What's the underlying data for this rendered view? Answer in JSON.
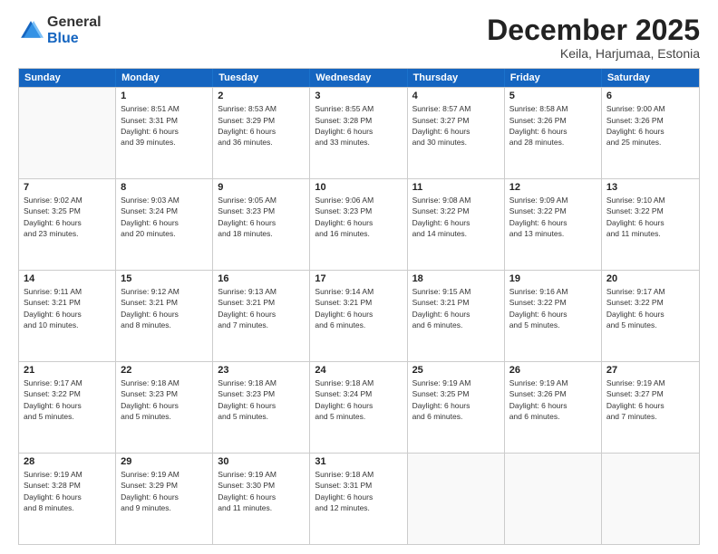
{
  "header": {
    "logo_general": "General",
    "logo_blue": "Blue",
    "title": "December 2025",
    "subtitle": "Keila, Harjumaa, Estonia"
  },
  "days_of_week": [
    "Sunday",
    "Monday",
    "Tuesday",
    "Wednesday",
    "Thursday",
    "Friday",
    "Saturday"
  ],
  "weeks": [
    [
      {
        "day": "",
        "info": ""
      },
      {
        "day": "1",
        "info": "Sunrise: 8:51 AM\nSunset: 3:31 PM\nDaylight: 6 hours\nand 39 minutes."
      },
      {
        "day": "2",
        "info": "Sunrise: 8:53 AM\nSunset: 3:29 PM\nDaylight: 6 hours\nand 36 minutes."
      },
      {
        "day": "3",
        "info": "Sunrise: 8:55 AM\nSunset: 3:28 PM\nDaylight: 6 hours\nand 33 minutes."
      },
      {
        "day": "4",
        "info": "Sunrise: 8:57 AM\nSunset: 3:27 PM\nDaylight: 6 hours\nand 30 minutes."
      },
      {
        "day": "5",
        "info": "Sunrise: 8:58 AM\nSunset: 3:26 PM\nDaylight: 6 hours\nand 28 minutes."
      },
      {
        "day": "6",
        "info": "Sunrise: 9:00 AM\nSunset: 3:26 PM\nDaylight: 6 hours\nand 25 minutes."
      }
    ],
    [
      {
        "day": "7",
        "info": "Sunrise: 9:02 AM\nSunset: 3:25 PM\nDaylight: 6 hours\nand 23 minutes."
      },
      {
        "day": "8",
        "info": "Sunrise: 9:03 AM\nSunset: 3:24 PM\nDaylight: 6 hours\nand 20 minutes."
      },
      {
        "day": "9",
        "info": "Sunrise: 9:05 AM\nSunset: 3:23 PM\nDaylight: 6 hours\nand 18 minutes."
      },
      {
        "day": "10",
        "info": "Sunrise: 9:06 AM\nSunset: 3:23 PM\nDaylight: 6 hours\nand 16 minutes."
      },
      {
        "day": "11",
        "info": "Sunrise: 9:08 AM\nSunset: 3:22 PM\nDaylight: 6 hours\nand 14 minutes."
      },
      {
        "day": "12",
        "info": "Sunrise: 9:09 AM\nSunset: 3:22 PM\nDaylight: 6 hours\nand 13 minutes."
      },
      {
        "day": "13",
        "info": "Sunrise: 9:10 AM\nSunset: 3:22 PM\nDaylight: 6 hours\nand 11 minutes."
      }
    ],
    [
      {
        "day": "14",
        "info": "Sunrise: 9:11 AM\nSunset: 3:21 PM\nDaylight: 6 hours\nand 10 minutes."
      },
      {
        "day": "15",
        "info": "Sunrise: 9:12 AM\nSunset: 3:21 PM\nDaylight: 6 hours\nand 8 minutes."
      },
      {
        "day": "16",
        "info": "Sunrise: 9:13 AM\nSunset: 3:21 PM\nDaylight: 6 hours\nand 7 minutes."
      },
      {
        "day": "17",
        "info": "Sunrise: 9:14 AM\nSunset: 3:21 PM\nDaylight: 6 hours\nand 6 minutes."
      },
      {
        "day": "18",
        "info": "Sunrise: 9:15 AM\nSunset: 3:21 PM\nDaylight: 6 hours\nand 6 minutes."
      },
      {
        "day": "19",
        "info": "Sunrise: 9:16 AM\nSunset: 3:22 PM\nDaylight: 6 hours\nand 5 minutes."
      },
      {
        "day": "20",
        "info": "Sunrise: 9:17 AM\nSunset: 3:22 PM\nDaylight: 6 hours\nand 5 minutes."
      }
    ],
    [
      {
        "day": "21",
        "info": "Sunrise: 9:17 AM\nSunset: 3:22 PM\nDaylight: 6 hours\nand 5 minutes."
      },
      {
        "day": "22",
        "info": "Sunrise: 9:18 AM\nSunset: 3:23 PM\nDaylight: 6 hours\nand 5 minutes."
      },
      {
        "day": "23",
        "info": "Sunrise: 9:18 AM\nSunset: 3:23 PM\nDaylight: 6 hours\nand 5 minutes."
      },
      {
        "day": "24",
        "info": "Sunrise: 9:18 AM\nSunset: 3:24 PM\nDaylight: 6 hours\nand 5 minutes."
      },
      {
        "day": "25",
        "info": "Sunrise: 9:19 AM\nSunset: 3:25 PM\nDaylight: 6 hours\nand 6 minutes."
      },
      {
        "day": "26",
        "info": "Sunrise: 9:19 AM\nSunset: 3:26 PM\nDaylight: 6 hours\nand 6 minutes."
      },
      {
        "day": "27",
        "info": "Sunrise: 9:19 AM\nSunset: 3:27 PM\nDaylight: 6 hours\nand 7 minutes."
      }
    ],
    [
      {
        "day": "28",
        "info": "Sunrise: 9:19 AM\nSunset: 3:28 PM\nDaylight: 6 hours\nand 8 minutes."
      },
      {
        "day": "29",
        "info": "Sunrise: 9:19 AM\nSunset: 3:29 PM\nDaylight: 6 hours\nand 9 minutes."
      },
      {
        "day": "30",
        "info": "Sunrise: 9:19 AM\nSunset: 3:30 PM\nDaylight: 6 hours\nand 11 minutes."
      },
      {
        "day": "31",
        "info": "Sunrise: 9:18 AM\nSunset: 3:31 PM\nDaylight: 6 hours\nand 12 minutes."
      },
      {
        "day": "",
        "info": ""
      },
      {
        "day": "",
        "info": ""
      },
      {
        "day": "",
        "info": ""
      }
    ]
  ]
}
